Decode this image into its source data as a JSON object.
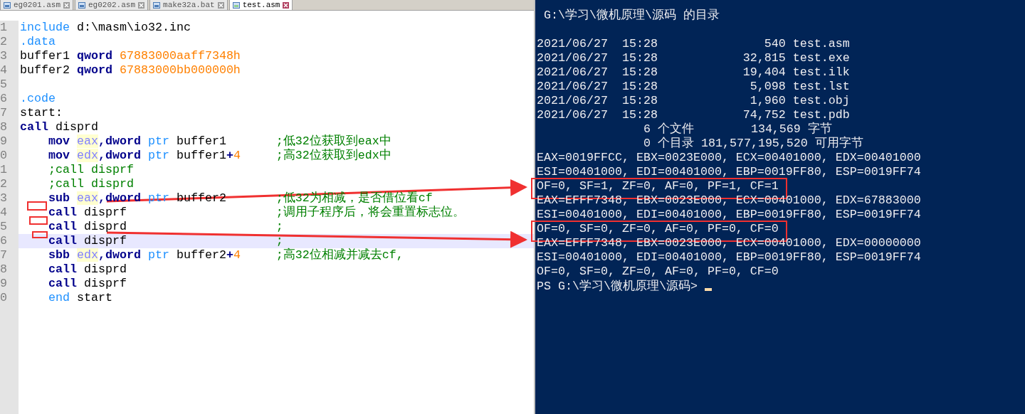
{
  "editor": {
    "tabs": [
      {
        "label": "eg0201.asm",
        "selected": false
      },
      {
        "label": "eg0202.asm",
        "selected": false
      },
      {
        "label": "make32a.bat",
        "selected": false
      },
      {
        "label": "test.asm",
        "selected": true
      }
    ],
    "lines": [
      {
        "number": "1",
        "indented": false,
        "current": false,
        "tokens": [
          {
            "kind": "dir",
            "text": "include"
          },
          {
            "kind": "text",
            "text": " d:\\masm\\io32.inc"
          }
        ]
      },
      {
        "number": "2",
        "indented": false,
        "current": false,
        "tokens": [
          {
            "kind": "dir",
            "text": ".data"
          }
        ]
      },
      {
        "number": "3",
        "indented": false,
        "current": false,
        "tokens": [
          {
            "kind": "text",
            "text": "buffer1 "
          },
          {
            "kind": "kw",
            "text": "qword"
          },
          {
            "kind": "num",
            "text": " 67883000aaff7348h"
          }
        ]
      },
      {
        "number": "4",
        "indented": false,
        "current": false,
        "tokens": [
          {
            "kind": "text",
            "text": "buffer2 "
          },
          {
            "kind": "kw",
            "text": "qword"
          },
          {
            "kind": "num",
            "text": " 67883000bb000000h"
          }
        ]
      },
      {
        "number": "5",
        "current": false
      },
      {
        "number": "6",
        "indented": false,
        "current": false,
        "tokens": [
          {
            "kind": "dir",
            "text": ".code"
          }
        ]
      },
      {
        "number": "7",
        "indented": false,
        "current": false,
        "tokens": [
          {
            "kind": "text",
            "text": "start:"
          }
        ]
      },
      {
        "number": "8",
        "indented": false,
        "current": false,
        "tokens": [
          {
            "kind": "kw",
            "text": "call"
          },
          {
            "kind": "text",
            "text": " disprd"
          }
        ]
      },
      {
        "number": "9",
        "indented": true,
        "current": false,
        "tokens": [
          {
            "kind": "kw",
            "text": "mov"
          },
          {
            "kind": "reg",
            "text": "eax"
          },
          {
            "kind": "kw",
            "text": ",dword"
          },
          {
            "kind": "dir",
            "text": " ptr"
          },
          {
            "kind": "text",
            "text": " buffer1"
          }
        ],
        "comment": ";低32位获取到eax中"
      },
      {
        "number": "0",
        "indented": true,
        "current": false,
        "tokens": [
          {
            "kind": "kw",
            "text": "mov"
          },
          {
            "kind": "reg",
            "text": "edx"
          },
          {
            "kind": "kw",
            "text": ",dword"
          },
          {
            "kind": "dir",
            "text": " ptr"
          },
          {
            "kind": "text",
            "text": " buffer1"
          },
          {
            "kind": "kw",
            "text": "+"
          },
          {
            "kind": "num",
            "text": "4"
          }
        ],
        "comment": ";高32位获取到edx中"
      },
      {
        "number": "1",
        "indented": true,
        "current": false,
        "tokens": [
          {
            "kind": "comment",
            "text": ";call disprf"
          }
        ]
      },
      {
        "number": "2",
        "indented": true,
        "current": false,
        "tokens": [
          {
            "kind": "comment",
            "text": ";call disprd"
          }
        ]
      },
      {
        "number": "3",
        "indented": true,
        "current": false,
        "tokens": [
          {
            "kind": "kw",
            "text": "sub"
          },
          {
            "kind": "reg",
            "text": "eax"
          },
          {
            "kind": "kw",
            "text": ",dword"
          },
          {
            "kind": "dir",
            "text": " ptr"
          },
          {
            "kind": "text",
            "text": " buffer2"
          }
        ],
        "comment": ";低32为相减，是否借位看cf"
      },
      {
        "number": "4",
        "indented": true,
        "current": false,
        "tokens": [
          {
            "kind": "kw",
            "text": "call"
          },
          {
            "kind": "text",
            "text": " disprf"
          }
        ],
        "comment": ";调用子程序后，将会重置标志位。"
      },
      {
        "number": "5",
        "indented": true,
        "current": false,
        "tokens": [
          {
            "kind": "kw",
            "text": "call"
          },
          {
            "kind": "text",
            "text": " disprd"
          }
        ],
        "comment": ";"
      },
      {
        "number": "6",
        "indented": true,
        "current": true,
        "tokens": [
          {
            "kind": "kw",
            "text": "call"
          },
          {
            "kind": "text",
            "text": " disprf"
          }
        ],
        "comment": ";"
      },
      {
        "number": "7",
        "indented": true,
        "current": false,
        "tokens": [
          {
            "kind": "kw",
            "text": "sbb"
          },
          {
            "kind": "reg",
            "text": "edx"
          },
          {
            "kind": "kw",
            "text": ",dword"
          },
          {
            "kind": "dir",
            "text": " ptr"
          },
          {
            "kind": "text",
            "text": " buffer2"
          },
          {
            "kind": "kw",
            "text": "+"
          },
          {
            "kind": "num",
            "text": "4"
          }
        ],
        "comment": ";高32位相减并减去cf,"
      },
      {
        "number": "8",
        "indented": true,
        "current": false,
        "tokens": [
          {
            "kind": "kw",
            "text": "call"
          },
          {
            "kind": "text",
            "text": " disprd"
          }
        ]
      },
      {
        "number": "9",
        "indented": true,
        "current": false,
        "tokens": [
          {
            "kind": "kw",
            "text": "call"
          },
          {
            "kind": "text",
            "text": " disprf"
          }
        ]
      },
      {
        "number": "0",
        "indented": true,
        "current": false,
        "tokens": [
          {
            "kind": "dir",
            "text": "end"
          },
          {
            "kind": "text",
            "text": " start"
          }
        ]
      }
    ]
  },
  "console": {
    "title": " G:\\学习\\微机原理\\源码 的目录",
    "lines": [
      {
        "text": "2021/06/27  15:28               540 test.asm",
        "boxed": false
      },
      {
        "text": "2021/06/27  15:28            32,815 test.exe",
        "boxed": false
      },
      {
        "text": "2021/06/27  15:28            19,404 test.ilk",
        "boxed": false
      },
      {
        "text": "2021/06/27  15:28             5,098 test.lst",
        "boxed": false
      },
      {
        "text": "2021/06/27  15:28             1,960 test.obj",
        "boxed": false
      },
      {
        "text": "2021/06/27  15:28            74,752 test.pdb",
        "boxed": false
      },
      {
        "text": "               6 个文件        134,569 字节",
        "boxed": false
      },
      {
        "text": "               0 个目录 181,577,195,520 可用字节",
        "boxed": false
      },
      {
        "text": "EAX=0019FFCC, EBX=0023E000, ECX=00401000, EDX=00401000",
        "boxed": false
      },
      {
        "text": "ESI=00401000, EDI=00401000, EBP=0019FF80, ESP=0019FF74",
        "boxed": false
      },
      {
        "text": "OF=0, SF=1, ZF=0, AF=0, PF=1, CF=1",
        "boxed": true
      },
      {
        "text": "EAX=EFFF7348, EBX=0023E000, ECX=00401000, EDX=67883000",
        "boxed": false
      },
      {
        "text": "ESI=00401000, EDI=00401000, EBP=0019FF80, ESP=0019FF74",
        "boxed": false
      },
      {
        "text": "OF=0, SF=0, ZF=0, AF=0, PF=0, CF=0",
        "boxed": true
      },
      {
        "text": "EAX=EFFF7348, EBX=0023E000, ECX=00401000, EDX=00000000",
        "boxed": false
      },
      {
        "text": "ESI=00401000, EDI=00401000, EBP=0019FF80, ESP=0019FF74",
        "boxed": false
      },
      {
        "text": "OF=0, SF=0, ZF=0, AF=0, PF=0, CF=0",
        "boxed": false
      }
    ],
    "prompt": "PS G:\\学习\\微机原理\\源码> "
  }
}
